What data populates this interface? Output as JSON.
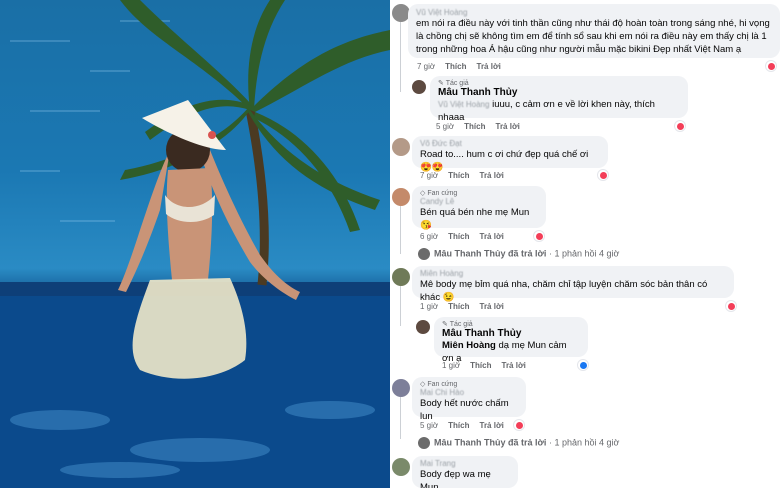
{
  "post": {
    "image_alt": ""
  },
  "comments": [
    {
      "name": "Vũ Việt Hoàng",
      "text": "em nói ra điều này với tinh thần cũng như thái độ hoàn toàn trong sáng nhé, hi vọng là chồng chị sẽ không tìm em để tính sổ sau khi em nói ra điều này em thấy chị là 1 trong những hoa Á hậu cũng như người mẫu mặc bikini Đẹp nhất Việt Nam ạ",
      "time": "7 giờ",
      "like": "Thích",
      "reply": "Trả lời"
    },
    {
      "badge": "Tác giả",
      "name": "Mâu Thanh Thủy",
      "mention": "Vũ Việt Hoàng",
      "text": "iuuu, c cảm ơn e về lời khen này, thích nhaaa",
      "time": "5 giờ",
      "like": "Thích",
      "reply": "Trả lời"
    },
    {
      "name": "Võ Đức Đạt",
      "text": "Road to.... hum c ơi chứ đẹp quá chế ơi 😍😍",
      "time": "7 giờ",
      "like": "Thích",
      "reply": "Trả lời"
    },
    {
      "badge": "Fan cứng",
      "name": "Candy Lê",
      "text": "Bén quá bén nhe mẹ Mun 😘",
      "time": "6 giờ",
      "like": "Thích",
      "reply": "Trả lời",
      "replies": {
        "author": "Mâu Thanh Thủy",
        "label": "đã trả lời",
        "count": "· 1 phản hồi",
        "time": "4 giờ"
      }
    },
    {
      "name": "Miên Hoàng",
      "text": "Mê body mẹ bỉm quá nha, chăm chỉ tập luyện chăm sóc bản thân có khác 😉",
      "time": "1 giờ",
      "like": "Thích",
      "reply": "Trả lời"
    },
    {
      "badge": "Tác giả",
      "name": "Mâu Thanh Thủy",
      "mention": "Miên Hoàng",
      "text": "dạ mẹ Mun cảm ơn ạ",
      "time": "1 giờ",
      "like": "Thích",
      "reply": "Trả lời"
    },
    {
      "badge": "Fan cứng",
      "name": "Mai Chi Hào",
      "text": "Body hết nước chấm lun",
      "time": "5 giờ",
      "like": "Thích",
      "reply": "Trả lời",
      "replies": {
        "author": "Mâu Thanh Thủy",
        "label": "đã trả lời",
        "count": "· 1 phản hồi",
        "time": "4 giờ"
      }
    },
    {
      "name": "Mai Trang",
      "text": "Body đẹp wa mẹ Mun"
    }
  ]
}
